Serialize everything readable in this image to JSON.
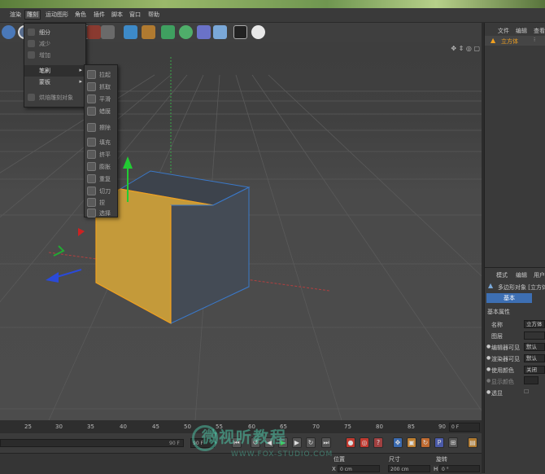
{
  "menubar": {
    "items": [
      "",
      "渲染",
      "雕刻",
      "运动图形",
      "角色",
      "插件",
      "脚本",
      "窗口",
      "帮助"
    ],
    "active_index": 2
  },
  "toolbar": {
    "icons": [
      "y-axis-icon",
      "z-axis-icon",
      "coord-icon",
      "render-region-icon",
      "render-view-icon",
      "render-settings-icon",
      "cube-icon",
      "pen-spline-icon",
      "subdivision-icon",
      "cloner-icon",
      "deformer-icon",
      "floor-icon",
      "camera-icon",
      "light-icon"
    ]
  },
  "dropdown": {
    "items": [
      {
        "label": "细分",
        "enabled": true,
        "submenu": false
      },
      {
        "label": "减少",
        "enabled": false,
        "submenu": false
      },
      {
        "label": "增加",
        "enabled": false,
        "submenu": false
      },
      {
        "label": "笔刷",
        "enabled": true,
        "submenu": true,
        "highlight": true
      },
      {
        "label": "蒙板",
        "enabled": true,
        "submenu": true
      },
      {
        "label": "烘焙雕刻对象",
        "enabled": false,
        "submenu": false
      }
    ]
  },
  "submenu": {
    "items": [
      "拉起",
      "抓取",
      "平滑",
      "蜡膜",
      "擦除",
      "填充",
      "挤平",
      "膨胀",
      "重复",
      "切刀",
      "捏",
      "选择"
    ]
  },
  "viewport": {
    "nav_icons": "✥ ⇕ ◎ ▢",
    "accent_color": "#f0a020"
  },
  "timeline": {
    "ticks": [
      "25",
      "30",
      "35",
      "40",
      "45",
      "50",
      "55",
      "60",
      "65",
      "70",
      "75",
      "80",
      "85",
      "90"
    ],
    "frame_field": "0 F",
    "end_field": "90 F",
    "end_field2": "90 F"
  },
  "coordinates": {
    "pos_label": "位置",
    "size_label": "尺寸",
    "rot_label": "旋转",
    "x_label": "X",
    "x_pos": "0 cm",
    "x_size": "200 cm",
    "h_label": "H",
    "h_rot": "0 °"
  },
  "watermark": {
    "main": "微视听教程",
    "sub": "WWW.FOX-STUDIO.COM"
  },
  "right_panel": {
    "top_tabs": [
      "文件",
      "编辑",
      "查看"
    ],
    "object_name": "立方体",
    "attr_tabs": [
      "模式",
      "编辑",
      "用户"
    ],
    "object_type": "多边形对象 [立方体",
    "basic_tab": "基本",
    "basic_props_header": "基本属性",
    "props": [
      {
        "label": "名称",
        "value": "立方体"
      },
      {
        "label": "图层",
        "value": ""
      },
      {
        "label": "编辑器可见",
        "value": "默认"
      },
      {
        "label": "渲染器可见",
        "value": "默认"
      },
      {
        "label": "使用颜色",
        "value": "关闭"
      },
      {
        "label": "显示颜色",
        "value": ""
      },
      {
        "label": "透显",
        "value": ""
      }
    ]
  }
}
